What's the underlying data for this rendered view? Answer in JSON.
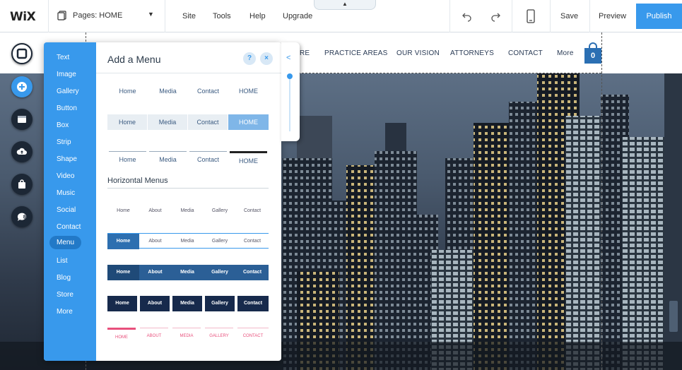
{
  "topbar": {
    "logo": "WiX",
    "pages_label": "Pages: HOME",
    "menus": [
      "Site",
      "Tools",
      "Help",
      "Upgrade"
    ],
    "save": "Save",
    "preview": "Preview",
    "publish": "Publish"
  },
  "site": {
    "nav": [
      "RE",
      "PRACTICE AREAS",
      "OUR VISION",
      "ATTORNEYS",
      "CONTACT",
      "More"
    ],
    "cart_count": "0"
  },
  "panel": {
    "title": "Add a Menu",
    "help": "?",
    "close": "×",
    "categories": [
      "Text",
      "Image",
      "Gallery",
      "Button",
      "Box",
      "Strip",
      "Shape",
      "Video",
      "Music",
      "Social",
      "Contact",
      "Menu",
      "List",
      "Blog",
      "Store",
      "More"
    ],
    "selected_category": "Menu",
    "section_title": "Horizontal Menus",
    "menu_row1": [
      "Home",
      "Media",
      "Contact",
      "HOME"
    ],
    "menu_row2": [
      "Home",
      "About",
      "Media",
      "Gallery",
      "Contact"
    ]
  },
  "colors": {
    "accent": "#3899ec",
    "panel_categories": "#3899ec",
    "dark_nav": "#1f3a5c",
    "navy": "#172a4c",
    "pink": "#e8507c"
  }
}
